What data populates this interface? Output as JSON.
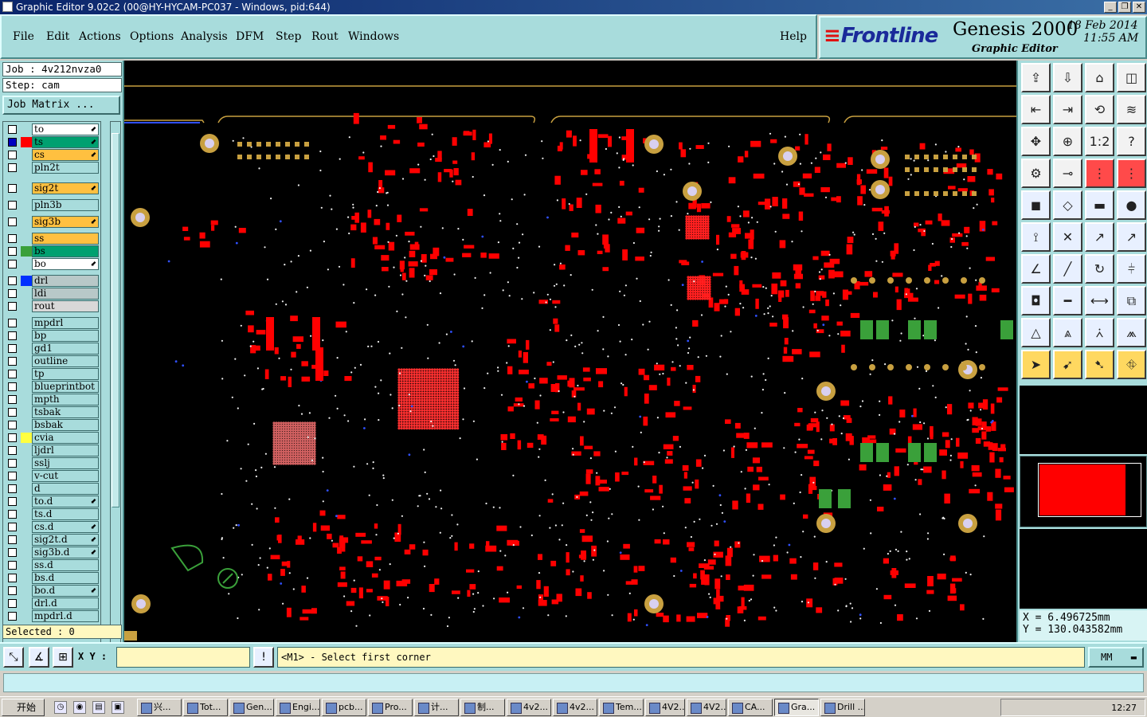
{
  "window": {
    "title": "Graphic Editor 9.02c2 (00@HY-HYCAM-PC037 - Windows, pid:644)",
    "buttons": [
      "_",
      "❐",
      "✕"
    ]
  },
  "menu": {
    "items": [
      "File",
      "Edit",
      "Actions",
      "Options",
      "Analysis",
      "DFM",
      "Step",
      "Rout",
      "Windows"
    ],
    "help": "Help"
  },
  "brand": {
    "logo": "Frontline",
    "product": "Genesis 2000",
    "subtitle": "Graphic Editor",
    "date": "18 Feb 2014",
    "time": "11:55 AM"
  },
  "job": {
    "job_label": "Job : 4v212nvza0",
    "step_label": "Step: cam",
    "matrix_button": "Job Matrix ..."
  },
  "layers": [
    {
      "name": "to",
      "color": "#ffffff",
      "swatch": "",
      "checked": false,
      "arrow": true
    },
    {
      "name": "ts",
      "color": "#00a070",
      "swatch": "#ff0000",
      "checked": true,
      "arrow": true
    },
    {
      "name": "cs",
      "color": "#ffc040",
      "swatch": "",
      "checked": false,
      "arrow": true
    },
    {
      "name": "pln2t",
      "color": "#a8dcdc",
      "swatch": "",
      "checked": false,
      "arrow": false
    },
    {
      "name": "sig2t",
      "color": "#ffc040",
      "swatch": "",
      "checked": false,
      "arrow": true
    },
    {
      "name": "pln3b",
      "color": "#a8dcdc",
      "swatch": "",
      "checked": false,
      "arrow": false
    },
    {
      "name": "sig3b",
      "color": "#ffc040",
      "swatch": "",
      "checked": false,
      "arrow": true
    },
    {
      "name": "ss",
      "color": "#ffc040",
      "swatch": "",
      "checked": false,
      "arrow": false
    },
    {
      "name": "bs",
      "color": "#00a070",
      "swatch": "#3aa03a",
      "checked": false,
      "arrow": false
    },
    {
      "name": "bo",
      "color": "#ffffff",
      "swatch": "",
      "checked": false,
      "arrow": true
    },
    {
      "name": "drl",
      "color": "#b8c8c8",
      "swatch": "#0030ff",
      "checked": false,
      "arrow": false
    },
    {
      "name": "ldi",
      "color": "#b8c8c8",
      "swatch": "",
      "checked": false,
      "arrow": false
    },
    {
      "name": "rout",
      "color": "#d8d8d8",
      "swatch": "",
      "checked": false,
      "arrow": false
    },
    {
      "name": "mpdrl",
      "color": "#a8dcdc",
      "swatch": "",
      "checked": false,
      "arrow": false
    },
    {
      "name": "bp",
      "color": "#a8dcdc",
      "swatch": "",
      "checked": false,
      "arrow": false
    },
    {
      "name": "gd1",
      "color": "#a8dcdc",
      "swatch": "",
      "checked": false,
      "arrow": false
    },
    {
      "name": "outline",
      "color": "#a8dcdc",
      "swatch": "",
      "checked": false,
      "arrow": false
    },
    {
      "name": "tp",
      "color": "#a8dcdc",
      "swatch": "",
      "checked": false,
      "arrow": false
    },
    {
      "name": "blueprintbot",
      "color": "#a8dcdc",
      "swatch": "",
      "checked": false,
      "arrow": false
    },
    {
      "name": "mpth",
      "color": "#a8dcdc",
      "swatch": "",
      "checked": false,
      "arrow": false
    },
    {
      "name": "tsbak",
      "color": "#a8dcdc",
      "swatch": "",
      "checked": false,
      "arrow": false
    },
    {
      "name": "bsbak",
      "color": "#a8dcdc",
      "swatch": "",
      "checked": false,
      "arrow": false
    },
    {
      "name": "cvia",
      "color": "#a8dcdc",
      "swatch": "#ffff40",
      "checked": false,
      "arrow": false
    },
    {
      "name": "ljdrl",
      "color": "#a8dcdc",
      "swatch": "",
      "checked": false,
      "arrow": false
    },
    {
      "name": "sslj",
      "color": "#a8dcdc",
      "swatch": "",
      "checked": false,
      "arrow": false
    },
    {
      "name": "v-cut",
      "color": "#a8dcdc",
      "swatch": "",
      "checked": false,
      "arrow": false
    },
    {
      "name": "d",
      "color": "#a8dcdc",
      "swatch": "",
      "checked": false,
      "arrow": false
    },
    {
      "name": "to.d",
      "color": "#a8dcdc",
      "swatch": "",
      "checked": false,
      "arrow": true
    },
    {
      "name": "ts.d",
      "color": "#a8dcdc",
      "swatch": "",
      "checked": false,
      "arrow": false
    },
    {
      "name": "cs.d",
      "color": "#a8dcdc",
      "swatch": "",
      "checked": false,
      "arrow": true
    },
    {
      "name": "sig2t.d",
      "color": "#a8dcdc",
      "swatch": "",
      "checked": false,
      "arrow": true
    },
    {
      "name": "sig3b.d",
      "color": "#a8dcdc",
      "swatch": "",
      "checked": false,
      "arrow": true
    },
    {
      "name": "ss.d",
      "color": "#a8dcdc",
      "swatch": "",
      "checked": false,
      "arrow": false
    },
    {
      "name": "bs.d",
      "color": "#a8dcdc",
      "swatch": "",
      "checked": false,
      "arrow": false
    },
    {
      "name": "bo.d",
      "color": "#a8dcdc",
      "swatch": "",
      "checked": false,
      "arrow": true
    },
    {
      "name": "drl.d",
      "color": "#a8dcdc",
      "swatch": "",
      "checked": false,
      "arrow": false
    },
    {
      "name": "mpdrl.d",
      "color": "#a8dcdc",
      "swatch": "",
      "checked": false,
      "arrow": false
    }
  ],
  "selected": "Selected : 0",
  "tools": [
    {
      "icon": "⇪",
      "name": "upload-icon",
      "style": ""
    },
    {
      "icon": "⇩",
      "name": "download-icon",
      "style": ""
    },
    {
      "icon": "⌂",
      "name": "home-icon",
      "style": ""
    },
    {
      "icon": "◫",
      "name": "split-view-icon",
      "style": ""
    },
    {
      "icon": "⇤",
      "name": "pan-left-icon",
      "style": ""
    },
    {
      "icon": "⇥",
      "name": "pan-right-icon",
      "style": ""
    },
    {
      "icon": "⟲",
      "name": "rotate-icon",
      "style": ""
    },
    {
      "icon": "≋",
      "name": "wave-icon",
      "style": ""
    },
    {
      "icon": "✥",
      "name": "fit-icon",
      "style": ""
    },
    {
      "icon": "⊕",
      "name": "center-icon",
      "style": ""
    },
    {
      "icon": "1:2",
      "name": "scale-icon",
      "style": ""
    },
    {
      "icon": "?",
      "name": "help-icon",
      "style": ""
    },
    {
      "icon": "⚙",
      "name": "settings-icon",
      "style": ""
    },
    {
      "icon": "⊸",
      "name": "probe-icon",
      "style": ""
    },
    {
      "icon": "⋮",
      "name": "layers-red-icon",
      "style": "red"
    },
    {
      "icon": "⋮",
      "name": "layers-red2-icon",
      "style": "red"
    },
    {
      "icon": "◼",
      "name": "fill-icon",
      "style": "blue"
    },
    {
      "icon": "◇",
      "name": "shape-icon",
      "style": "blue"
    },
    {
      "icon": "▬",
      "name": "ruler-icon",
      "style": "blue"
    },
    {
      "icon": "●",
      "name": "pad-icon",
      "style": "blue"
    },
    {
      "icon": "⟟",
      "name": "node-icon",
      "style": "blue"
    },
    {
      "icon": "✕",
      "name": "cross-icon",
      "style": "blue"
    },
    {
      "icon": "↗",
      "name": "line-add-icon",
      "style": "blue"
    },
    {
      "icon": "↗",
      "name": "line-edit-icon",
      "style": "blue"
    },
    {
      "icon": "∠",
      "name": "angle-icon",
      "style": "blue"
    },
    {
      "icon": "╱",
      "name": "slash-icon",
      "style": "blue"
    },
    {
      "icon": "↻",
      "name": "arc-icon",
      "style": "blue"
    },
    {
      "icon": "⫩",
      "name": "join-icon",
      "style": "blue"
    },
    {
      "icon": "◘",
      "name": "select-box-icon",
      "style": "blue"
    },
    {
      "icon": "━",
      "name": "minus-icon",
      "style": "blue"
    },
    {
      "icon": "⟷",
      "name": "measure-icon",
      "style": "blue"
    },
    {
      "icon": "⧉",
      "name": "group-icon",
      "style": "blue"
    },
    {
      "icon": "△",
      "name": "triangle-icon",
      "style": "blue"
    },
    {
      "icon": "⩓",
      "name": "triangle2-icon",
      "style": "blue"
    },
    {
      "icon": "⩑",
      "name": "triangle3-icon",
      "style": "blue"
    },
    {
      "icon": "⩕",
      "name": "triangle4-icon",
      "style": "blue"
    },
    {
      "icon": "➤",
      "name": "pointer-icon",
      "style": "sel"
    },
    {
      "icon": "➹",
      "name": "pointer-box-icon",
      "style": "sel"
    },
    {
      "icon": "➷",
      "name": "pointer-sel-icon",
      "style": "sel"
    },
    {
      "icon": "⛗",
      "name": "route-icon",
      "style": "sel"
    }
  ],
  "coords": {
    "x": "X =   6.496725mm",
    "y": "Y = 130.043582mm"
  },
  "bottom": {
    "xy_label": "X Y :",
    "xy_value": "",
    "prompt": "<M1> - Select first corner",
    "units": "MM"
  },
  "taskbar": {
    "start": "开始",
    "tasks": [
      "兴...",
      "Tot...",
      "Gen...",
      "Engi...",
      "pcb...",
      "Pro...",
      "计...",
      "制...",
      "4v2...",
      "4v2...",
      "Tem...",
      "4V2...",
      "4V2...",
      "CA...",
      "Gra...",
      "Drill ..."
    ],
    "active": "Gra...",
    "clock": "12:27"
  }
}
